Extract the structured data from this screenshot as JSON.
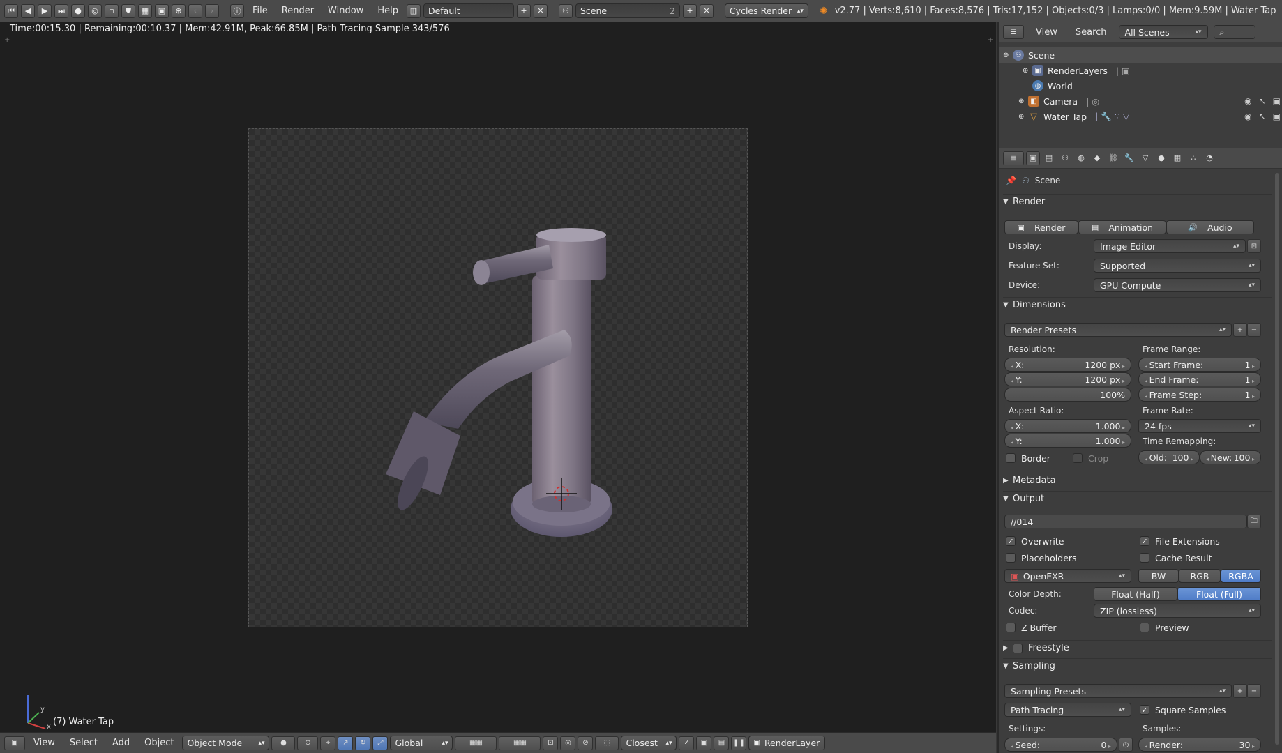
{
  "topbar": {
    "menus": [
      "File",
      "Render",
      "Window",
      "Help"
    ],
    "layout": "Default",
    "scene": "Scene",
    "scene_users": "2",
    "engine": "Cycles Render",
    "stats": "v2.77 | Verts:8,610 | Faces:8,576 | Tris:17,152 | Objects:0/3 | Lamps:0/0 | Mem:9.59M | Water Tap"
  },
  "viewport": {
    "info": "Time:00:15.30 | Remaining:00:10.37 | Mem:42.91M, Peak:66.85M | Path Tracing Sample 343/576",
    "object_label": "(7) Water Tap",
    "axes": {
      "x": "x",
      "y": "y",
      "z": "z"
    }
  },
  "viewport_header": {
    "menus": [
      "View",
      "Select",
      "Add",
      "Object"
    ],
    "mode": "Object Mode",
    "orientation": "Global",
    "snap": "Closest",
    "render_layer": "RenderLayer"
  },
  "outliner": {
    "view": "View",
    "search": "Search",
    "filter": "All Scenes",
    "items": [
      "Scene",
      "RenderLayers",
      "World",
      "Camera",
      "Water Tap"
    ]
  },
  "properties": {
    "context": "Scene",
    "render": {
      "title": "Render",
      "render_btn": "Render",
      "animation_btn": "Animation",
      "audio_btn": "Audio",
      "display_label": "Display:",
      "display": "Image Editor",
      "feature_label": "Feature Set:",
      "feature": "Supported",
      "device_label": "Device:",
      "device": "GPU Compute"
    },
    "dimensions": {
      "title": "Dimensions",
      "presets": "Render Presets",
      "resolution_label": "Resolution:",
      "res_x_k": "X:",
      "res_x": "1200 px",
      "res_y_k": "Y:",
      "res_y": "1200 px",
      "res_pct": "100%",
      "frame_range_label": "Frame Range:",
      "start_k": "Start Frame:",
      "start": "1",
      "end_k": "End Frame:",
      "end": "1",
      "step_k": "Frame Step:",
      "step": "1",
      "aspect_label": "Aspect Ratio:",
      "asp_x_k": "X:",
      "asp_x": "1.000",
      "asp_y_k": "Y:",
      "asp_y": "1.000",
      "frame_rate_label": "Frame Rate:",
      "frame_rate": "24 fps",
      "remap_label": "Time Remapping:",
      "old_k": "Old:",
      "old": "100",
      "new_k": "New:",
      "new": "100",
      "border": "Border",
      "crop": "Crop"
    },
    "metadata": {
      "title": "Metadata"
    },
    "output": {
      "title": "Output",
      "path": "//014",
      "overwrite": "Overwrite",
      "file_ext": "File Extensions",
      "placeholders": "Placeholders",
      "cache": "Cache Result",
      "format": "OpenEXR",
      "bw": "BW",
      "rgb": "RGB",
      "rgba": "RGBA",
      "depth_label": "Color Depth:",
      "half": "Float (Half)",
      "full": "Float (Full)",
      "codec_label": "Codec:",
      "codec": "ZIP (lossless)",
      "zbuffer": "Z Buffer",
      "preview": "Preview"
    },
    "freestyle": {
      "title": "Freestyle"
    },
    "sampling": {
      "title": "Sampling",
      "presets": "Sampling Presets",
      "integrator": "Path Tracing",
      "square": "Square Samples",
      "settings_label": "Settings:",
      "samples_label": "Samples:",
      "seed_k": "Seed:",
      "seed": "0",
      "render_k": "Render:",
      "render": "30"
    }
  },
  "colors": {
    "accent": "#5680c2",
    "bg": "#393939",
    "viewport": "#1f1f1f"
  }
}
